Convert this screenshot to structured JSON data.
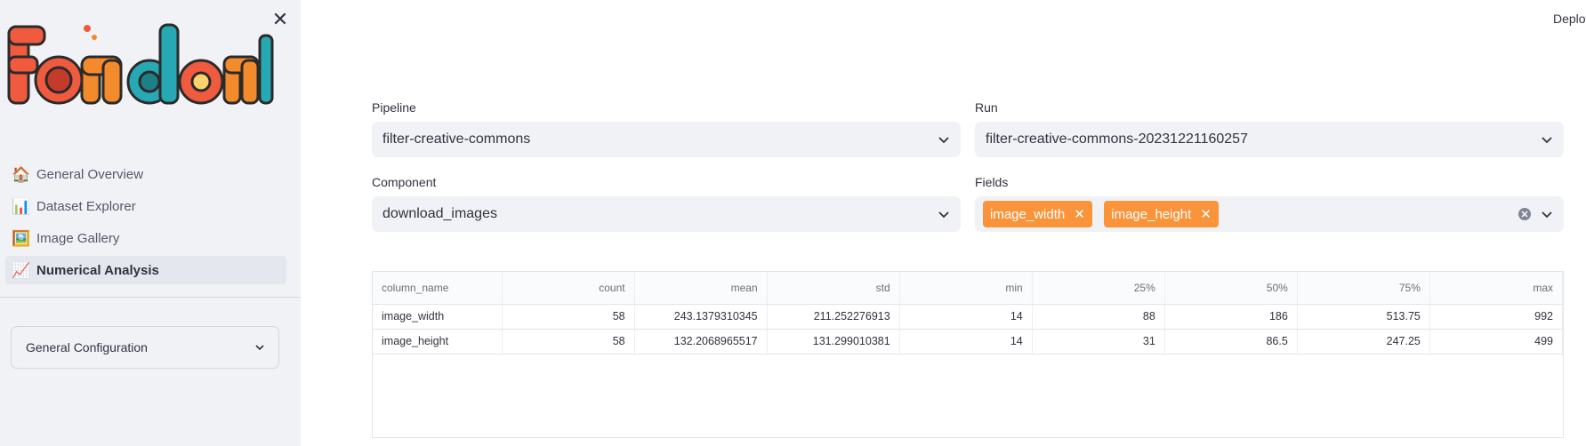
{
  "sidebar": {
    "logo_text": "Fondant",
    "nav_items": [
      {
        "emoji": "🏠",
        "label": "General Overview",
        "icon": "house-icon"
      },
      {
        "emoji": "📊",
        "label": "Dataset Explorer",
        "icon": "bar-chart-icon"
      },
      {
        "emoji": "🖼️",
        "label": "Image Gallery",
        "icon": "framed-picture-icon"
      },
      {
        "emoji": "📈",
        "label": "Numerical Analysis",
        "icon": "line-chart-icon"
      }
    ],
    "active_index": 3,
    "config_label": "General Configuration"
  },
  "header": {
    "deploy_label": "Deploy"
  },
  "form": {
    "pipeline_label": "Pipeline",
    "pipeline_value": "filter-creative-commons",
    "run_label": "Run",
    "run_value": "filter-creative-commons-20231221160257",
    "component_label": "Component",
    "component_value": "download_images",
    "fields_label": "Fields",
    "fields_tags": [
      "image_width",
      "image_height"
    ]
  },
  "table": {
    "columns": [
      "column_name",
      "count",
      "mean",
      "std",
      "min",
      "25%",
      "50%",
      "75%",
      "max"
    ],
    "rows": [
      [
        "image_width",
        "58",
        "243.1379310345",
        "211.252276913",
        "14",
        "88",
        "186",
        "513.75",
        "992"
      ],
      [
        "image_height",
        "58",
        "132.2068965517",
        "131.299010381",
        "14",
        "31",
        "86.5",
        "247.25",
        "499"
      ]
    ]
  },
  "colors": {
    "accent_tag": "#f9943b",
    "sidebar_bg": "#f0f2f6",
    "select_bg": "#f0f2f6"
  }
}
